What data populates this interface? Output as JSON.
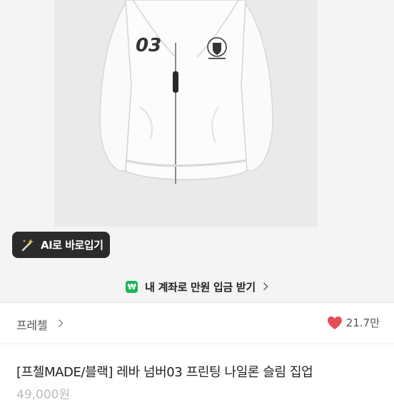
{
  "ai_button": {
    "label": "AI로 바로입기",
    "icon": "magic-wand-icon"
  },
  "account_banner": {
    "icon": "won-icon",
    "icon_glyph": "₩",
    "text": "내 계좌로 만원 입금 받기",
    "accent": "#20b25a"
  },
  "seller": {
    "name": "프레첼",
    "chevron": "chevron-right-icon"
  },
  "likes": {
    "count": "21.7만",
    "color": "#e64e57"
  },
  "product": {
    "title": "[프첼MADE/블랙] 레바 넘버03 프린팅 나일론 슬림 집업",
    "price": "49,000원",
    "jacket_number": "03"
  }
}
